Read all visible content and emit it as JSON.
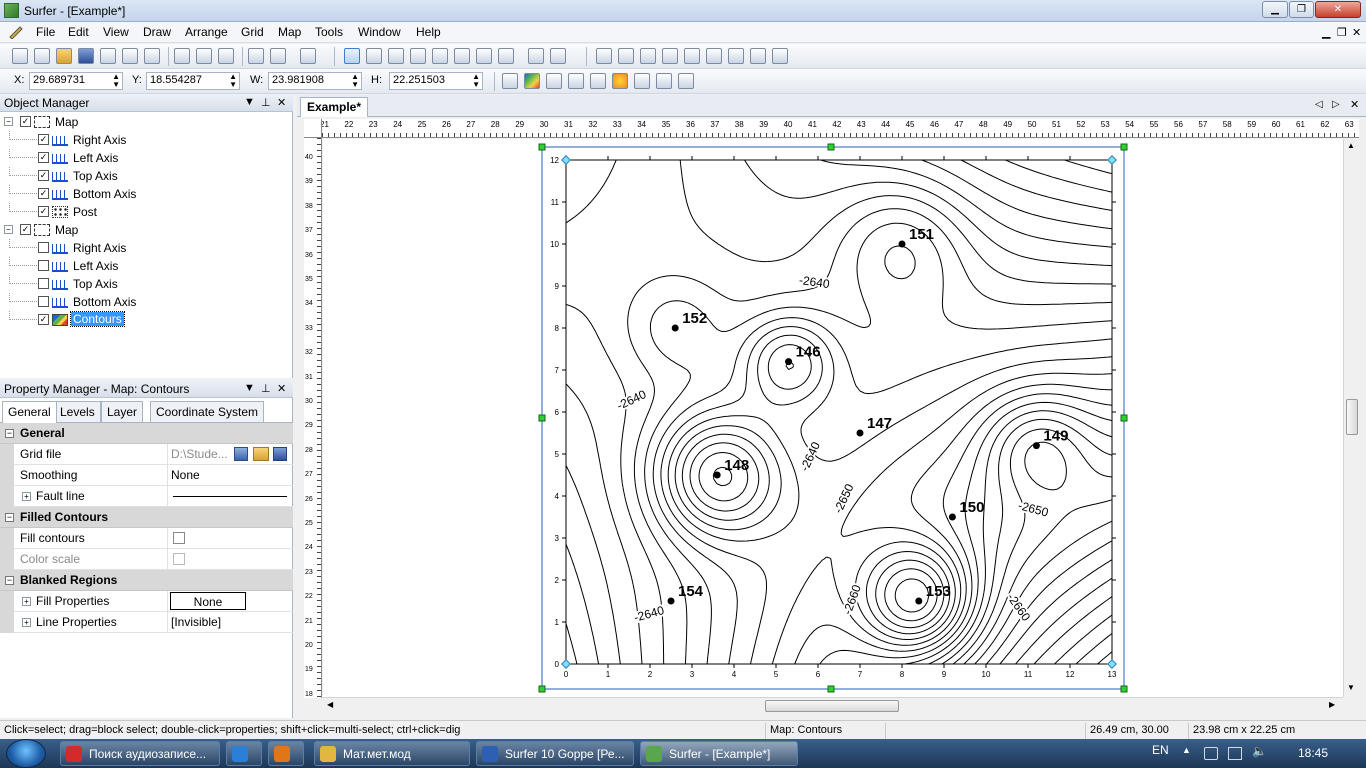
{
  "window": {
    "title": "Surfer - [Example*]"
  },
  "menu": [
    "File",
    "Edit",
    "View",
    "Draw",
    "Arrange",
    "Grid",
    "Map",
    "Tools",
    "Window",
    "Help"
  ],
  "coords": {
    "x_label": "X:",
    "x_value": "29.689731",
    "y_label": "Y:",
    "y_value": "18.554287",
    "w_label": "W:",
    "w_value": "23.981908",
    "h_label": "H:",
    "h_value": "22.251503"
  },
  "object_manager": {
    "title": "Object Manager",
    "items": [
      {
        "label": "Map",
        "level": 0,
        "checked": true,
        "icon": "map"
      },
      {
        "label": "Right Axis",
        "level": 1,
        "checked": true,
        "icon": "axis"
      },
      {
        "label": "Left Axis",
        "level": 1,
        "checked": true,
        "icon": "axis"
      },
      {
        "label": "Top Axis",
        "level": 1,
        "checked": true,
        "icon": "axis"
      },
      {
        "label": "Bottom Axis",
        "level": 1,
        "checked": true,
        "icon": "axis"
      },
      {
        "label": "Post",
        "level": 1,
        "checked": true,
        "icon": "post"
      },
      {
        "label": "Map",
        "level": 0,
        "checked": true,
        "icon": "map"
      },
      {
        "label": "Right Axis",
        "level": 1,
        "checked": false,
        "icon": "axis"
      },
      {
        "label": "Left Axis",
        "level": 1,
        "checked": false,
        "icon": "axis"
      },
      {
        "label": "Top Axis",
        "level": 1,
        "checked": false,
        "icon": "axis"
      },
      {
        "label": "Bottom Axis",
        "level": 1,
        "checked": false,
        "icon": "axis"
      },
      {
        "label": "Contours",
        "level": 1,
        "checked": true,
        "icon": "contour",
        "selected": true
      }
    ]
  },
  "property_manager": {
    "title": "Property Manager - Map: Contours",
    "tabs": [
      "General",
      "Levels",
      "Layer",
      "Coordinate System"
    ],
    "sections": {
      "general": "General",
      "filled": "Filled Contours",
      "blanked": "Blanked Regions"
    },
    "props": {
      "grid_file": {
        "name": "Grid file",
        "value": "D:\\Stude..."
      },
      "smoothing": {
        "name": "Smoothing",
        "value": "None"
      },
      "fault_line": {
        "name": "Fault line"
      },
      "fill_contours": {
        "name": "Fill contours"
      },
      "color_scale": {
        "name": "Color scale"
      },
      "fill_properties": {
        "name": "Fill Properties",
        "value": "None"
      },
      "line_properties": {
        "name": "Line Properties",
        "value": "[Invisible]"
      }
    }
  },
  "document": {
    "tab": "Example*",
    "hruler_labels": [
      "21",
      "22",
      "23",
      "24",
      "25",
      "26",
      "27",
      "28",
      "29",
      "30",
      "31",
      "32",
      "33",
      "34",
      "35",
      "36",
      "37",
      "38",
      "39",
      "40",
      "41",
      "42",
      "43",
      "44",
      "45",
      "46",
      "47",
      "48",
      "49",
      "50",
      "51",
      "52",
      "53",
      "54",
      "55",
      "56",
      "57",
      "58",
      "59",
      "60",
      "61",
      "62",
      "63"
    ],
    "vruler_labels": [
      "40",
      "39",
      "38",
      "37",
      "36",
      "35",
      "34",
      "33",
      "32",
      "31",
      "30",
      "29",
      "28",
      "27",
      "26",
      "25",
      "24",
      "23",
      "22",
      "21",
      "20",
      "19",
      "18"
    ]
  },
  "map": {
    "x_ticks": [
      "0",
      "1",
      "2",
      "3",
      "4",
      "5",
      "6",
      "7",
      "8",
      "9",
      "10",
      "11",
      "12",
      "13"
    ],
    "y_ticks": [
      "0",
      "1",
      "2",
      "3",
      "4",
      "5",
      "6",
      "7",
      "8",
      "9",
      "10",
      "11",
      "12"
    ],
    "wells": [
      {
        "label": "151",
        "x": 8.0,
        "y": 10.0
      },
      {
        "label": "152",
        "x": 2.6,
        "y": 8.0
      },
      {
        "label": "146",
        "x": 5.3,
        "y": 7.2
      },
      {
        "label": "147",
        "x": 7.0,
        "y": 5.5
      },
      {
        "label": "149",
        "x": 11.2,
        "y": 5.2
      },
      {
        "label": "148",
        "x": 3.6,
        "y": 4.5
      },
      {
        "label": "150",
        "x": 9.2,
        "y": 3.5
      },
      {
        "label": "154",
        "x": 2.5,
        "y": 1.5
      },
      {
        "label": "153",
        "x": 8.4,
        "y": 1.5
      }
    ],
    "contour_labels": [
      {
        "text": "-2640",
        "x": 5.9,
        "y": 9.0,
        "rotate": 8
      },
      {
        "text": "-2640",
        "x": 1.6,
        "y": 6.2,
        "rotate": -25
      },
      {
        "text": "-2640",
        "x": 5.9,
        "y": 4.9,
        "rotate": -65
      },
      {
        "text": "-2650",
        "x": 6.7,
        "y": 3.9,
        "rotate": -65
      },
      {
        "text": "-2650",
        "x": 11.1,
        "y": 3.6,
        "rotate": 15
      },
      {
        "text": "-2640",
        "x": 2.0,
        "y": 1.1,
        "rotate": -15
      },
      {
        "text": "-2660",
        "x": 6.9,
        "y": 1.5,
        "rotate": -70
      },
      {
        "text": "-2660",
        "x": 10.7,
        "y": 1.3,
        "rotate": 55
      }
    ]
  },
  "status": {
    "hint": "Click=select; drag=block select; double-click=properties; shift+click=multi-select; ctrl+click=dig",
    "selection": "Map: Contours",
    "position": "26.49 cm, 30.00 cm",
    "size": "23.98 cm x 22.25 cm"
  },
  "taskbar": {
    "items": [
      {
        "label": "Поиск аудиозаписе...",
        "color": "#d42a2a"
      },
      {
        "label": "",
        "color": "#2b7fd6"
      },
      {
        "label": "",
        "color": "#e0761a"
      },
      {
        "label": "Мат.мет.мод",
        "color": "#e3b642"
      },
      {
        "label": "Surfer 10 Goppe [Ре...",
        "color": "#2d5fb3"
      },
      {
        "label": "Surfer - [Example*]",
        "color": "#5aa64a"
      }
    ],
    "lang": "EN",
    "clock": "18:45"
  }
}
